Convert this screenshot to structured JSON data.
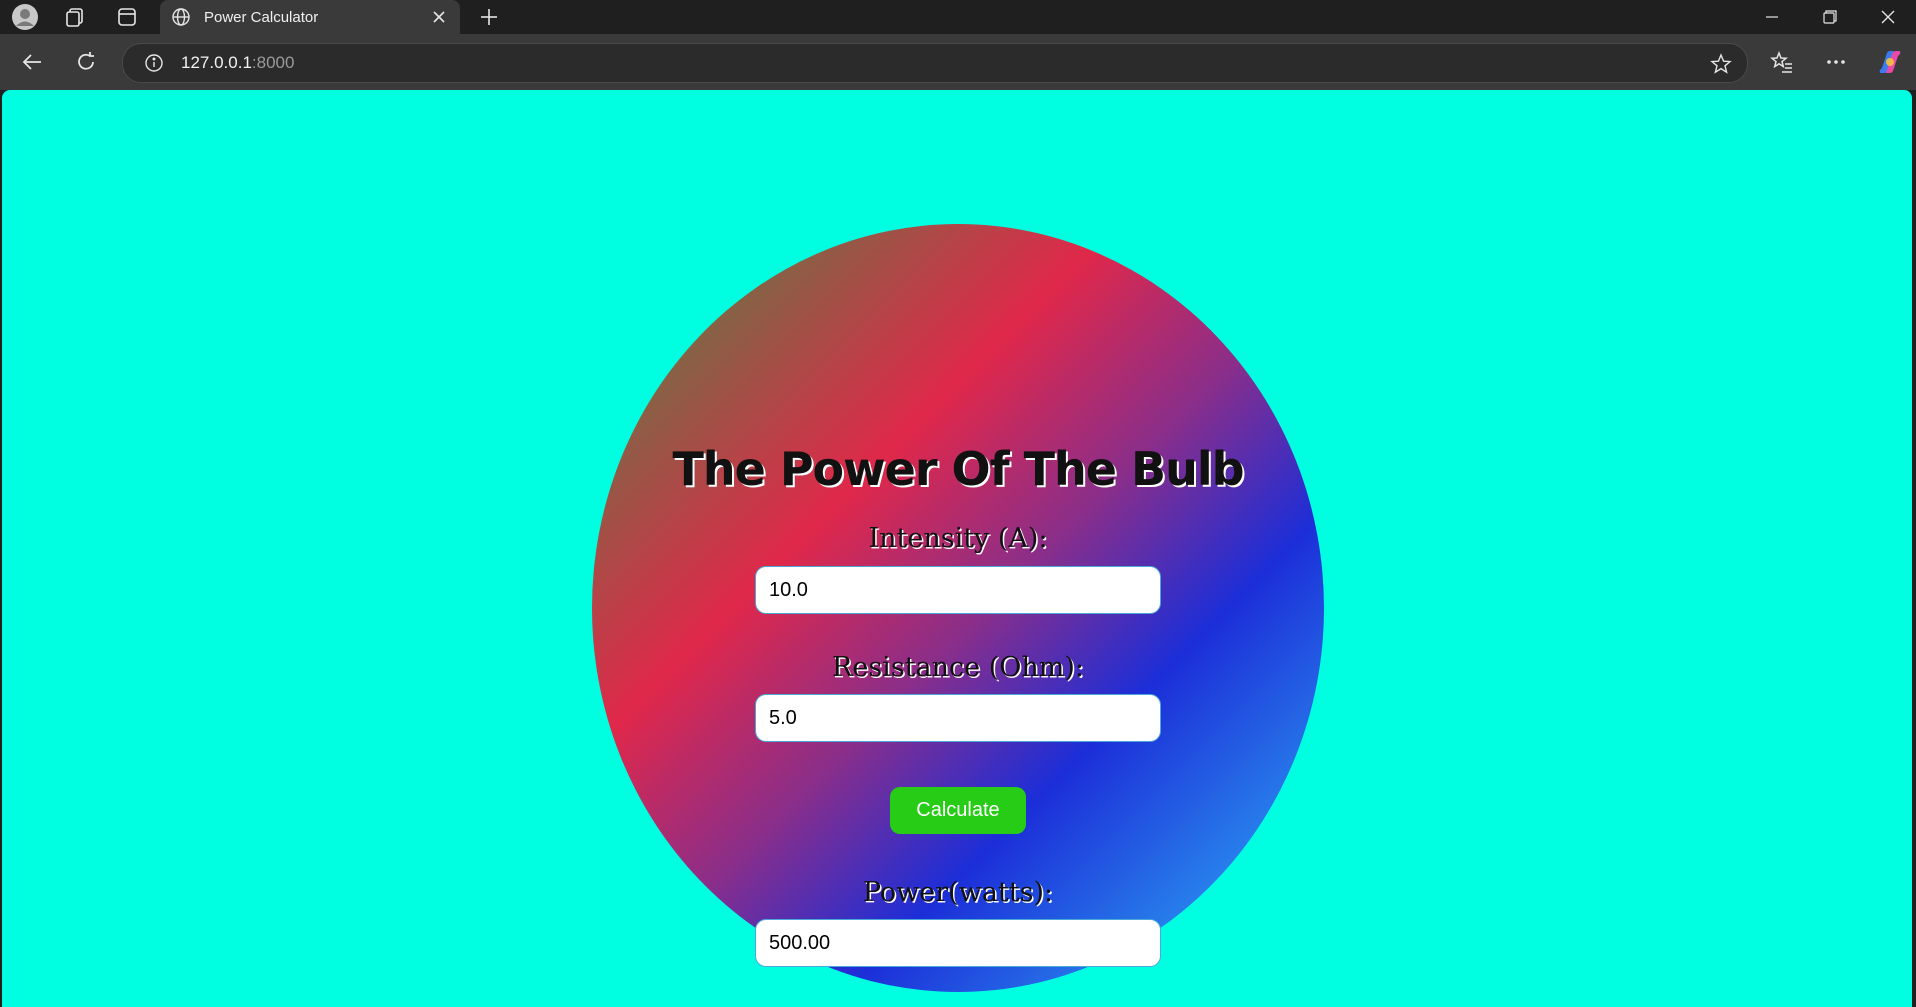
{
  "browser": {
    "tab": {
      "title": "Power Calculator"
    },
    "address": {
      "host": "127.0.0.1",
      "port": ":8000"
    }
  },
  "page": {
    "background_color": "#00FFE1",
    "heading": "The Power Of The Bulb",
    "intensity": {
      "label": "Intensity (A):",
      "value": "10.0"
    },
    "resistance": {
      "label": "Resistance (Ohm):",
      "value": "5.0"
    },
    "calculate_label": "Calculate",
    "power": {
      "label": "Power(watts):",
      "value": "500.00"
    }
  }
}
